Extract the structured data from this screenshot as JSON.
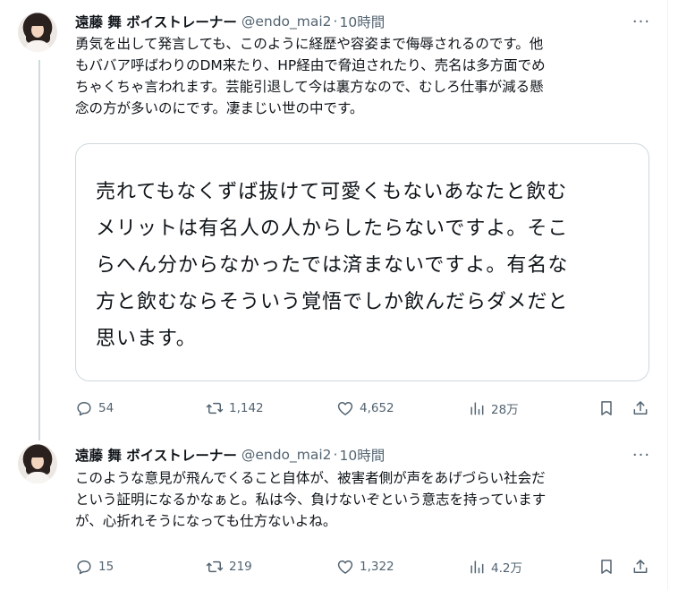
{
  "tweets": [
    {
      "author_name": "遠藤 舞 ボイストレーナー",
      "handle": "@endo_mai2",
      "separator": "·",
      "time": "10時間",
      "more": "···",
      "text": "勇気を出して発言しても、このように経歴や容姿まで侮辱されるのです。他\nもババア呼ばわりのDM来たり、HP経由で脅迫されたり、売名は多方面でめ\nちゃくちゃ言われます。芸能引退して今は裏方なので、むしろ仕事が減る懸\n念の方が多いのにです。凄まじい世の中です。",
      "quote_text": "売れてもなくずば抜けて可愛くもないあなたと飲む\nメリットは有名人の人からしたらないですよ。そこ\nらへん分からなかったでは済まないですよ。有名な\n方と飲むならそういう覚悟でしか飲んだらダメだと\n思います。",
      "replies": "54",
      "retweets": "1,142",
      "likes": "4,652",
      "views": "28万"
    },
    {
      "author_name": "遠藤 舞 ボイストレーナー",
      "handle": "@endo_mai2",
      "separator": "·",
      "time": "10時間",
      "more": "···",
      "text": "このような意見が飛んでくること自体が、被害者側が声をあげづらい社会だ\nという証明になるかなぁと。私は今、負けないぞという意志を持っています\nが、心折れそうになっても仕方ないよね。",
      "replies": "15",
      "retweets": "219",
      "likes": "1,322",
      "views": "4.2万"
    }
  ]
}
